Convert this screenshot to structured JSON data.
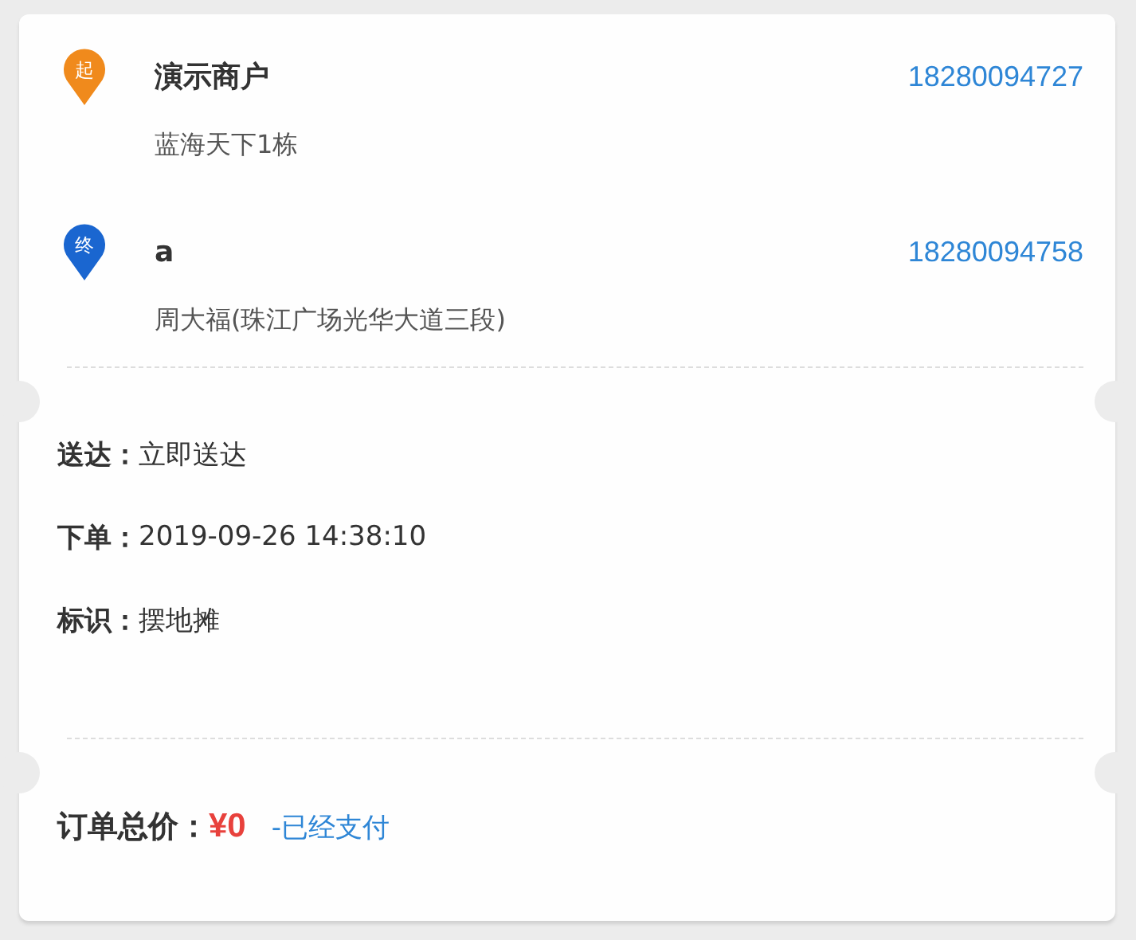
{
  "stops": [
    {
      "marker": "起",
      "color": "#f08a1c",
      "name": "演示商户",
      "phone": "18280094727",
      "address": "蓝海天下1栋"
    },
    {
      "marker": "终",
      "color": "#1a66d0",
      "name": "a",
      "phone": "18280094758",
      "address": "周大福(珠江广场光华大道三段)"
    }
  ],
  "details": [
    {
      "label": "送达：",
      "value": "立即送达"
    },
    {
      "label": "下单：",
      "value": "2019-09-26 14:38:10"
    },
    {
      "label": "标识：",
      "value": "摆地摊"
    }
  ],
  "total": {
    "label": "订单总价：",
    "amount": "¥0",
    "status": "-已经支付"
  }
}
